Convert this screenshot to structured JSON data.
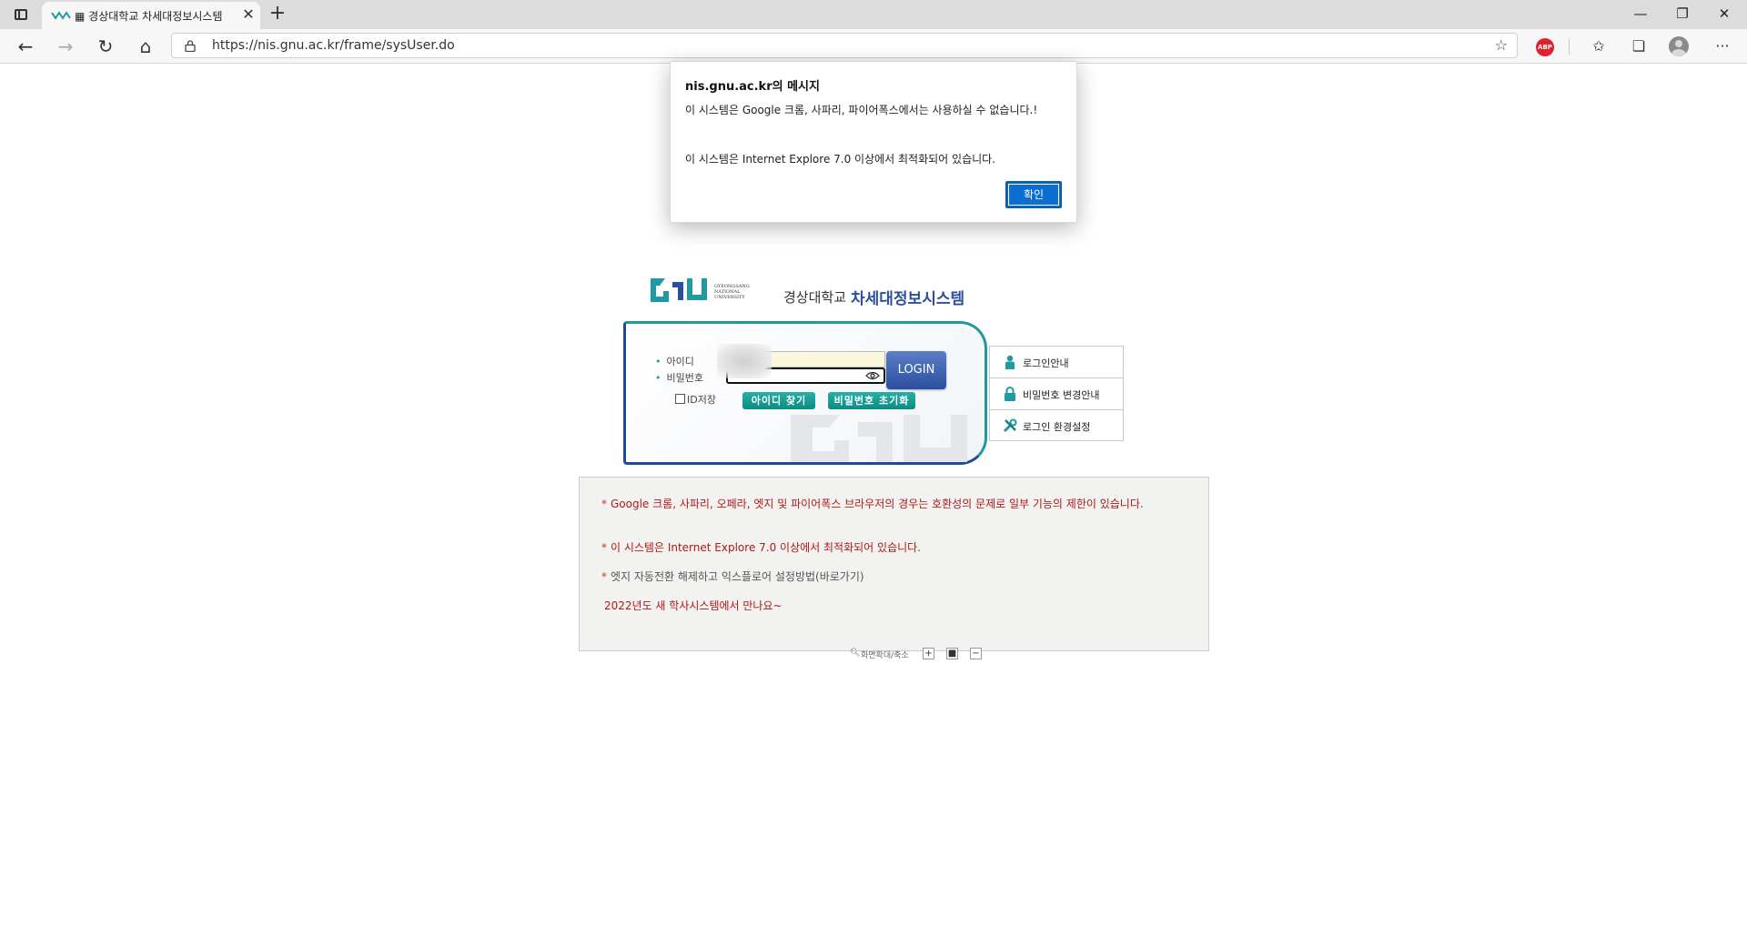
{
  "browser": {
    "tab_title": "▦ 경상대학교 차세대정보시스템",
    "tab_close": "✕",
    "new_tab": "+",
    "url": "https://nis.gnu.ac.kr/frame/sysUser.do",
    "window_controls": {
      "minimize": "—",
      "maximize": "❐",
      "close": "✕"
    },
    "nav": {
      "back": "←",
      "forward": "→",
      "refresh": "↻",
      "home": "⌂"
    },
    "toolbar": {
      "favorite_add": "☆",
      "abp": "ABP",
      "favorites": "✩",
      "collections": "❏",
      "more": "···"
    }
  },
  "alert": {
    "title": "nis.gnu.ac.kr의 메시지",
    "message_line1": "이 시스템은  Google 크롬, 사파리, 파이어폭스에서는 사용하실 수 없습니다.!",
    "message_line2": "이 시스템은 Internet Explore 7.0 이상에서 최적화되어 있습니다.",
    "ok_label": "확인"
  },
  "header": {
    "logo_sub": [
      "GYEONGSANG",
      "NATIONAL",
      "UNIVERSITY"
    ],
    "university_name": "경상대학교",
    "system_name": "차세대정보시스템"
  },
  "login": {
    "id_label": "아이디",
    "password_label": "비밀번호",
    "login_button": "LOGIN",
    "save_id_label": "ID저장",
    "save_id_checked": false,
    "find_id_button": "아이디 찾기",
    "reset_password_button": "비밀번호 초기화"
  },
  "side_links": [
    {
      "label": "로그인안내",
      "icon": "person-icon"
    },
    {
      "label": "비밀번호 변경안내",
      "icon": "lock-icon"
    },
    {
      "label": "로그인 환경설정",
      "icon": "tools-icon"
    }
  ],
  "notices": {
    "line1": "Google 크롬, 사파리, 오페라, 엣지 및 파이어폭스 브라우저의 경우는 호환성의 문제로 일부 기능의 제한이 있습니다.",
    "line2": "이 시스템은 Internet Explore 7.0 이상에서 최적화되어 있습니다.",
    "line3": "엣지 자동전환 해제하고 익스플로어 설정방법(바로가기)",
    "line4": "2022년도 새 학사시스템에서 만나요~",
    "star": "*"
  },
  "zoom": {
    "label": "화면확대/축소",
    "zoom_in": "+",
    "reset": "■",
    "zoom_out": "−"
  },
  "colors": {
    "teal": "#1f9aa0",
    "navy": "#2a4f9c",
    "notice_red": "#b01818",
    "alert_button": "#0a6fd1"
  }
}
